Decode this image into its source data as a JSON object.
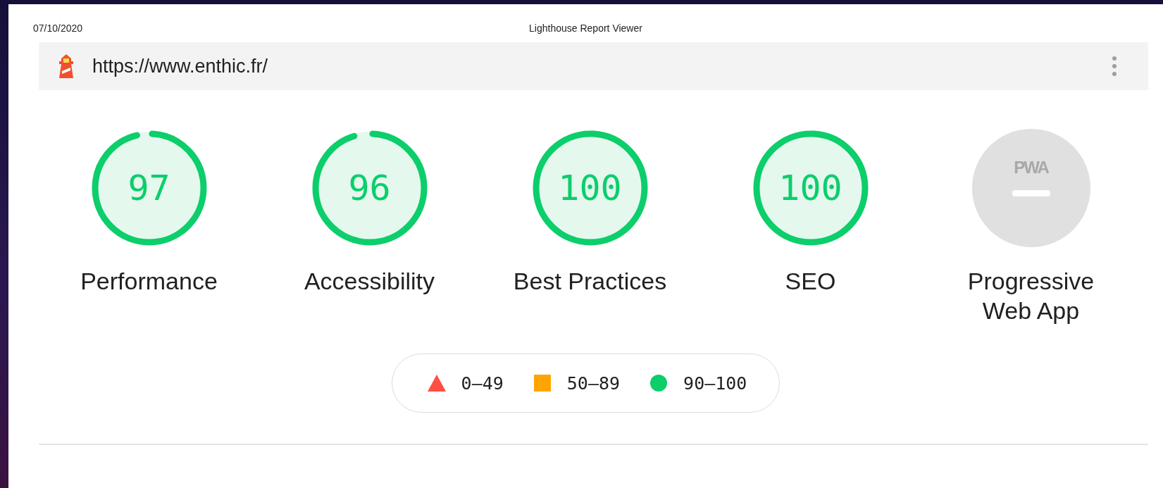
{
  "header": {
    "date": "07/10/2020",
    "title": "Lighthouse Report Viewer"
  },
  "topbar": {
    "url": "https://www.enthic.fr/"
  },
  "gauges": [
    {
      "kind": "score",
      "score": "97",
      "level": 0.97,
      "label": "Performance"
    },
    {
      "kind": "score",
      "score": "96",
      "level": 0.96,
      "label": "Accessibility"
    },
    {
      "kind": "score",
      "score": "100",
      "level": 1,
      "label": "Best Practices"
    },
    {
      "kind": "score",
      "score": "100",
      "level": 1,
      "label": "SEO"
    },
    {
      "kind": "pwa",
      "badge": "PWA",
      "label": "Progressive Web App"
    }
  ],
  "legend": [
    {
      "kind": "triangle",
      "color": "#ff4e42",
      "range": "0–49"
    },
    {
      "kind": "square",
      "color": "#ffa400",
      "range": "50–89"
    },
    {
      "kind": "circle",
      "color": "#0cce6b",
      "range": "90–100"
    }
  ]
}
